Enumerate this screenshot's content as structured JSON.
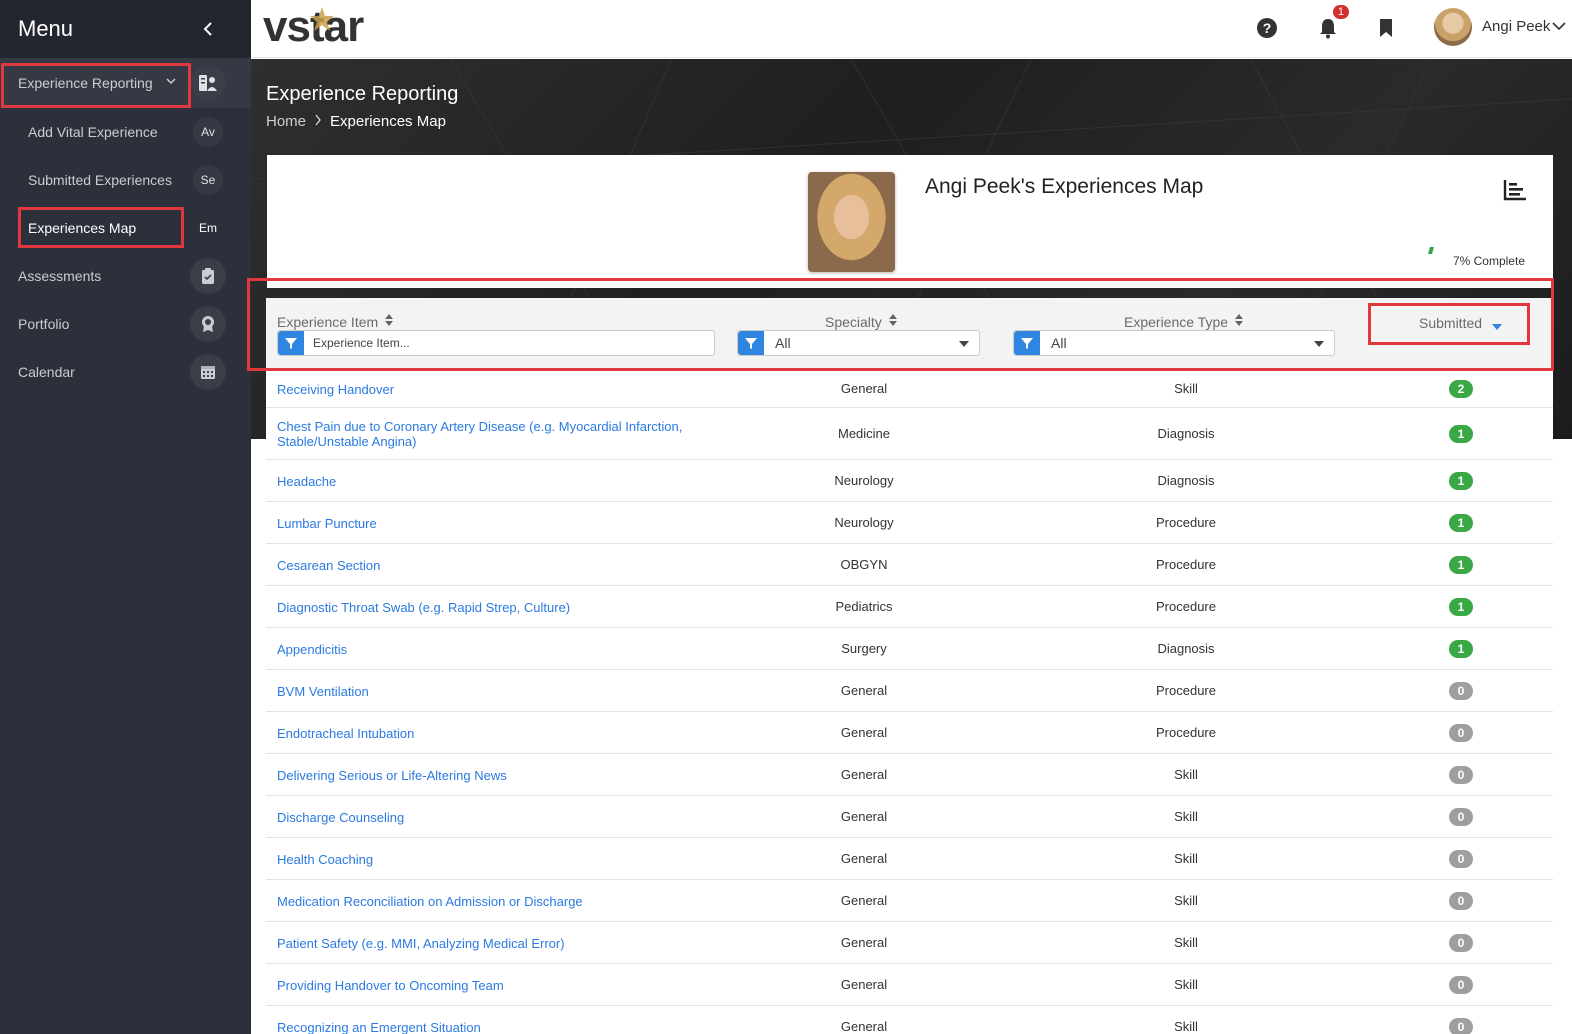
{
  "sidebar": {
    "title": "Menu",
    "items": [
      {
        "label": "Experience Reporting",
        "badge": "",
        "icon": "reporting-icon"
      },
      {
        "label": "Add Vital Experience",
        "badge": "Av"
      },
      {
        "label": "Submitted Experiences",
        "badge": "Se"
      },
      {
        "label": "Experiences Map",
        "badge": "Em"
      },
      {
        "label": "Assessments",
        "icon": "clipboard-icon"
      },
      {
        "label": "Portfolio",
        "icon": "award-icon"
      },
      {
        "label": "Calendar",
        "icon": "calendar-icon"
      }
    ]
  },
  "topbar": {
    "logo": "vstar",
    "notifications_count": "1",
    "user_name": "Angi Peek"
  },
  "hero": {
    "title": "Experience Reporting",
    "breadcrumb": [
      "Home",
      "Experiences Map"
    ]
  },
  "profile": {
    "map_title": "Angi Peek's Experiences Map",
    "complete_text": "7% Complete",
    "complete_percent": 7
  },
  "table": {
    "headers": {
      "item": "Experience Item",
      "specialty": "Specialty",
      "type": "Experience Type",
      "submitted": "Submitted"
    },
    "filters": {
      "item_placeholder": "Experience Item...",
      "specialty_value": "All",
      "type_value": "All"
    },
    "rows": [
      {
        "item": "Receiving Handover",
        "specialty": "General",
        "type": "Skill",
        "submitted": "2"
      },
      {
        "item": "Chest Pain due to Coronary Artery Disease (e.g. Myocardial Infarction, Stable/Unstable Angina)",
        "specialty": "Medicine",
        "type": "Diagnosis",
        "submitted": "1"
      },
      {
        "item": "Headache",
        "specialty": "Neurology",
        "type": "Diagnosis",
        "submitted": "1"
      },
      {
        "item": "Lumbar Puncture",
        "specialty": "Neurology",
        "type": "Procedure",
        "submitted": "1"
      },
      {
        "item": "Cesarean Section",
        "specialty": "OBGYN",
        "type": "Procedure",
        "submitted": "1"
      },
      {
        "item": "Diagnostic Throat Swab (e.g. Rapid Strep, Culture)",
        "specialty": "Pediatrics",
        "type": "Procedure",
        "submitted": "1"
      },
      {
        "item": "Appendicitis",
        "specialty": "Surgery",
        "type": "Diagnosis",
        "submitted": "1"
      },
      {
        "item": "BVM Ventilation",
        "specialty": "General",
        "type": "Procedure",
        "submitted": "0"
      },
      {
        "item": "Endotracheal Intubation",
        "specialty": "General",
        "type": "Procedure",
        "submitted": "0"
      },
      {
        "item": "Delivering Serious or Life-Altering News",
        "specialty": "General",
        "type": "Skill",
        "submitted": "0"
      },
      {
        "item": "Discharge Counseling",
        "specialty": "General",
        "type": "Skill",
        "submitted": "0"
      },
      {
        "item": "Health Coaching",
        "specialty": "General",
        "type": "Skill",
        "submitted": "0"
      },
      {
        "item": "Medication Reconciliation on Admission or Discharge",
        "specialty": "General",
        "type": "Skill",
        "submitted": "0"
      },
      {
        "item": "Patient Safety (e.g. MMI, Analyzing Medical Error)",
        "specialty": "General",
        "type": "Skill",
        "submitted": "0"
      },
      {
        "item": "Providing Handover to Oncoming Team",
        "specialty": "General",
        "type": "Skill",
        "submitted": "0"
      },
      {
        "item": "Recognizing an Emergent Situation",
        "specialty": "General",
        "type": "Skill",
        "submitted": "0"
      }
    ]
  },
  "colors": {
    "sidebar_bg": "#2c303a",
    "link": "#2a7ae2",
    "badge_green": "#3aa845",
    "badge_gray": "#9e9e9e",
    "highlight": "#e0383e",
    "filter_btn": "#2f86e0"
  }
}
